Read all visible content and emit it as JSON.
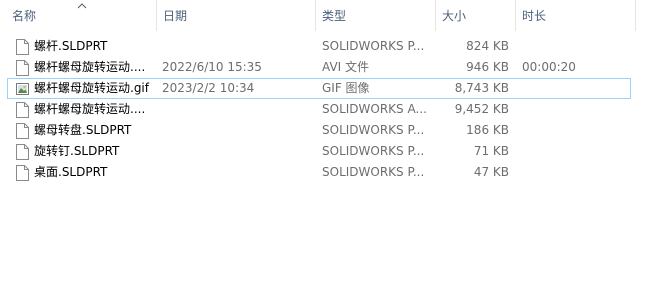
{
  "columns": {
    "name": "名称",
    "date": "日期",
    "type": "类型",
    "size": "大小",
    "duration": "时长"
  },
  "files": [
    {
      "name": "螺杆.SLDPRT",
      "date": "",
      "type": "SOLIDWORKS P...",
      "size": "824 KB",
      "duration": "",
      "icon": "document-icon"
    },
    {
      "name": "螺杆螺母旋转运动....",
      "date": "2022/6/10 15:35",
      "type": "AVI 文件",
      "size": "946 KB",
      "duration": "00:00:20",
      "icon": "document-icon"
    },
    {
      "name": "螺杆螺母旋转运动.gif",
      "date": "2023/2/2 10:34",
      "type": "GIF 图像",
      "size": "8,743 KB",
      "duration": "",
      "icon": "image-file-icon"
    },
    {
      "name": "螺杆螺母旋转运动....",
      "date": "",
      "type": "SOLIDWORKS A...",
      "size": "9,452 KB",
      "duration": "",
      "icon": "document-icon"
    },
    {
      "name": "螺母转盘.SLDPRT",
      "date": "",
      "type": "SOLIDWORKS P...",
      "size": "186 KB",
      "duration": "",
      "icon": "document-icon"
    },
    {
      "name": "旋转钉.SLDPRT",
      "date": "",
      "type": "SOLIDWORKS P...",
      "size": "71 KB",
      "duration": "",
      "icon": "document-icon"
    },
    {
      "name": "桌面.SLDPRT",
      "date": "",
      "type": "SOLIDWORKS P...",
      "size": "47 KB",
      "duration": "",
      "icon": "document-icon"
    }
  ],
  "selected_row": 2
}
